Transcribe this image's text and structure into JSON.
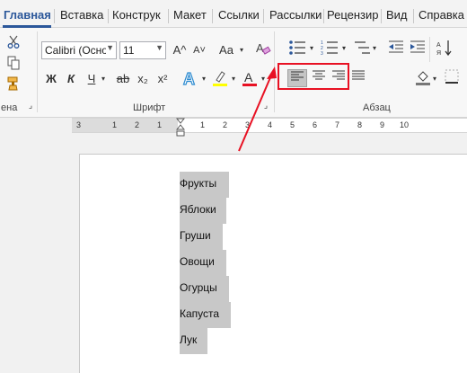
{
  "tabs": [
    {
      "label": "Главная",
      "active": true
    },
    {
      "label": "Вставка"
    },
    {
      "label": "Конструк"
    },
    {
      "label": "Макет"
    },
    {
      "label": "Ссылки"
    },
    {
      "label": "Рассылки"
    },
    {
      "label": "Рецензир"
    },
    {
      "label": "Вид"
    },
    {
      "label": "Справка"
    }
  ],
  "clipboard": {
    "group_label": "ена"
  },
  "font": {
    "name": "Calibri (Осно",
    "size": "11",
    "grow": "A^",
    "shrink": "A˅",
    "case": "Aa",
    "bold": "Ж",
    "italic": "К",
    "underline": "Ч",
    "strike": "ab",
    "subscript": "x₂",
    "superscript": "x²",
    "group_label": "Шрифт"
  },
  "paragraph": {
    "group_label": "Абзац"
  },
  "ruler": {
    "numbers": [
      "3",
      "1",
      "2",
      "1",
      "1",
      "2",
      "3",
      "4",
      "5",
      "6",
      "7",
      "8",
      "9",
      "10"
    ]
  },
  "document": {
    "lines": [
      "Фрукты",
      "Яблоки",
      "Груши",
      "Овощи",
      "Огурцы",
      "Капуста",
      "Лук"
    ]
  },
  "colors": {
    "accent": "#2b579a",
    "highlight": "#e81123",
    "selection": "#c8c8c8"
  }
}
